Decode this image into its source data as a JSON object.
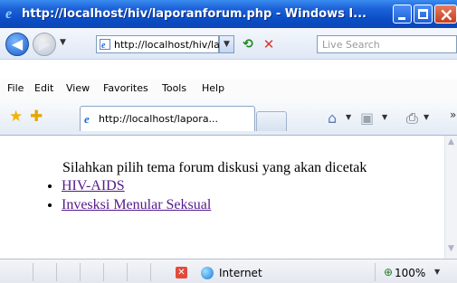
{
  "window": {
    "title": "http://localhost/hiv/laporanforum.php - Windows I..."
  },
  "address_bar": {
    "url": "http://localhost/hiv/la",
    "search_placeholder": "Live Search"
  },
  "menu": {
    "items": [
      "File",
      "Edit",
      "View",
      "Favorites",
      "Tools",
      "Help"
    ]
  },
  "tabs": {
    "active_label": "http://localhost/lapora..."
  },
  "content": {
    "intro": "Silahkan pilih tema forum diskusi yang akan dicetak",
    "links": [
      {
        "label": "HIV-AIDS"
      },
      {
        "label": "Invesksi Menular Seksual"
      }
    ]
  },
  "status": {
    "zone": "Internet",
    "zoom": "100%"
  },
  "icons": {
    "back": "back-arrow-icon",
    "forward": "forward-arrow-icon",
    "refresh": "refresh-icon",
    "stop": "stop-icon",
    "favorites": "favorites-star-icon",
    "add_favorite": "add-favorite-icon",
    "home": "home-icon",
    "feeds": "feeds-icon",
    "print": "print-icon"
  }
}
